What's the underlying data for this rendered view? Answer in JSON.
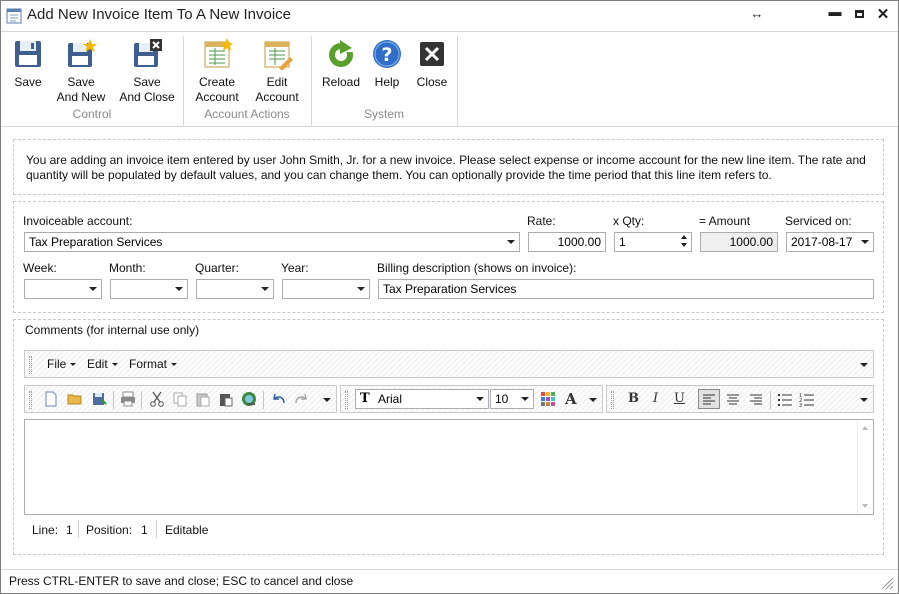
{
  "window": {
    "title": "Add New Invoice Item To A New Invoice"
  },
  "ribbon": {
    "groups": [
      {
        "label": "Control",
        "buttons": [
          {
            "label": "Save"
          },
          {
            "label": "Save And New"
          },
          {
            "label": "Save And Close"
          }
        ]
      },
      {
        "label": "Account Actions",
        "buttons": [
          {
            "label": "Create Account"
          },
          {
            "label": "Edit Account"
          }
        ]
      },
      {
        "label": "System",
        "buttons": [
          {
            "label": "Reload"
          },
          {
            "label": "Help"
          },
          {
            "label": "Close"
          }
        ]
      }
    ]
  },
  "info": {
    "text": "You are adding an invoice item entered by user John Smith, Jr. for a new invoice. Please select expense or income account for the new line item. The rate and quantity will be populated by default values, and you can change them. You can optionally provide the time period that this line item refers to."
  },
  "form": {
    "account_label": "Invoiceable account:",
    "account_value": "Tax Preparation Services",
    "rate_label": "Rate:",
    "rate_value": "1000.00",
    "qty_label": "x Qty:",
    "qty_value": "1",
    "amount_label": "= Amount",
    "amount_value": "1000.00",
    "serviced_label": "Serviced on:",
    "serviced_value": "2017-08-17",
    "week_label": "Week:",
    "week_value": "",
    "month_label": "Month:",
    "month_value": "",
    "quarter_label": "Quarter:",
    "quarter_value": "",
    "year_label": "Year:",
    "year_value": "",
    "billing_label": "Billing description (shows on invoice):",
    "billing_value": "Tax Preparation Services"
  },
  "comments": {
    "label": "Comments (for internal use only)",
    "menu": [
      {
        "label": "File"
      },
      {
        "label": "Edit"
      },
      {
        "label": "Format"
      }
    ],
    "font_name": "Arial",
    "font_size": "10",
    "body": ""
  },
  "editor_status": {
    "line_label": "Line:",
    "line_value": "1",
    "position_label": "Position:",
    "position_value": "1",
    "mode": "Editable"
  },
  "statusbar": {
    "text": "Press CTRL-ENTER to save and close; ESC to cancel and close"
  }
}
